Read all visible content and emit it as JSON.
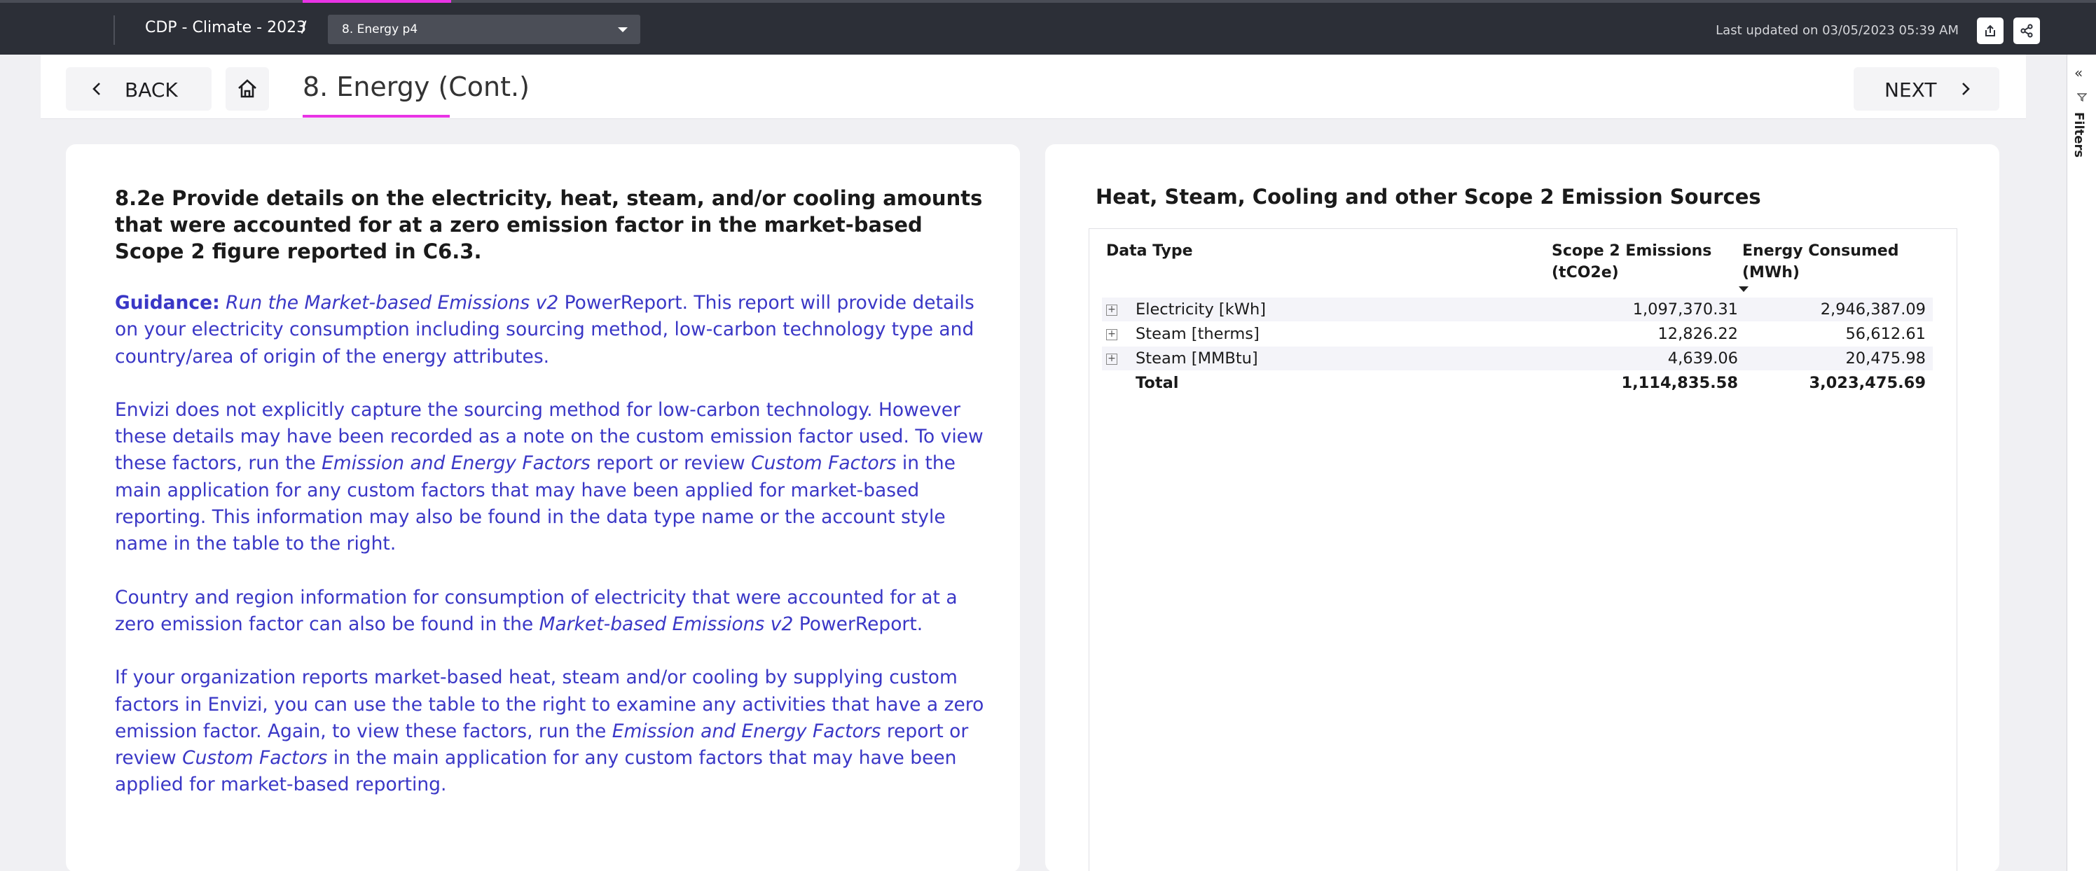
{
  "topbar": {
    "report_title": "CDP - Climate - 2023",
    "separator": "/",
    "page_selector_value": "8. Energy p4",
    "last_updated": "Last updated on 03/05/2023 05:39 AM",
    "export_icon": "export-icon",
    "share_icon": "share-icon"
  },
  "header": {
    "back_label": "BACK",
    "home_icon": "home-icon",
    "page_title": "8. Energy (Cont.)",
    "next_label": "NEXT"
  },
  "filters_rail": {
    "collapse_glyph": "«",
    "label": "Filters"
  },
  "question": {
    "heading": "8.2e Provide details on the electricity, heat, steam, and/or cooling amounts that were accounted for at a zero emission factor in the market-based Scope 2 figure reported in C6.3.",
    "guidance_label": "Guidance:",
    "p1_italic": "Run the Market-based Emissions v2",
    "p1_text": " PowerReport. This report will provide details on your electricity consumption including sourcing method, low-carbon technology type and country/area of origin of the energy attributes.",
    "p2_a": "Envizi does not explicitly capture the sourcing method for low-carbon technology. However these details may have been recorded as a note on the custom emission factor used. To view these factors, run the ",
    "p2_i1": "Emission and Energy Factors",
    "p2_b": " report or review ",
    "p2_i2": "Custom Factors",
    "p2_c": " in the main application for any custom factors that may have been applied for market-based reporting. This information may also be found in the data type name or the account style name in the table to the right.",
    "p3_a": "Country and region information for consumption of electricity that were accounted for at a zero emission factor can also be found in the ",
    "p3_i": "Market-based Emissions v2",
    "p3_b": " PowerReport.",
    "p4_a": "If your organization reports market-based heat, steam and/or cooling by supplying custom factors in Envizi, you can use the table to the right to examine any activities that have a zero emission factor. Again, to view these factors, run the ",
    "p4_i1": "Emission and Energy Factors",
    "p4_b": " report or review ",
    "p4_i2": "Custom Factors",
    "p4_c": " in the main application for any custom factors that may have been applied for market-based reporting."
  },
  "table": {
    "title": "Heat, Steam, Cooling and other Scope 2 Emission Sources",
    "columns": {
      "data_type": "Data Type",
      "scope2_line1": "Scope 2 Emissions",
      "scope2_line2": "(tCO2e)",
      "energy_line1": "Energy Consumed",
      "energy_line2": "(MWh)"
    },
    "rows": [
      {
        "label": "Electricity [kWh]",
        "scope2": "1,097,370.31",
        "energy": "2,946,387.09"
      },
      {
        "label": "Steam [therms]",
        "scope2": "12,826.22",
        "energy": "56,612.61"
      },
      {
        "label": "Steam [MMBtu]",
        "scope2": "4,639.06",
        "energy": "20,475.98"
      }
    ],
    "total": {
      "label": "Total",
      "scope2": "1,114,835.58",
      "energy": "3,023,475.69"
    }
  }
}
